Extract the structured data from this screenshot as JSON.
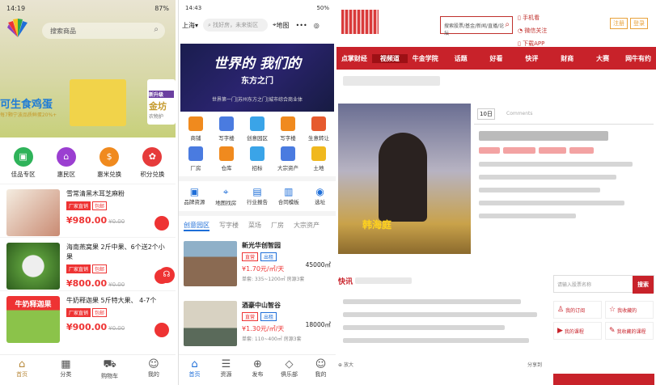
{
  "p1": {
    "status": {
      "time": "14:19",
      "battery": "87%"
    },
    "search_placeholder": "搜索商品",
    "banner": {
      "title": "可生食鸡蛋",
      "subtitle": "每7颗宁波品质鲜蛋20%+",
      "side_tag": "新升级",
      "side_title": "金坊",
      "side_sub": "农物护"
    },
    "categories": [
      {
        "label": "佳品专区"
      },
      {
        "label": "惠民区"
      },
      {
        "label": "惠米兑换"
      },
      {
        "label": "积分兑换"
      }
    ],
    "products": [
      {
        "name": "雪常清黑木耳芝麻粉",
        "tag1": "厂家直销",
        "tag2": "包邮",
        "price": "¥980.00",
        "old": "¥0.00"
      },
      {
        "name": "海南燕窝果 2斤中果、6个送2个小果",
        "tag1": "厂家直销",
        "tag2": "包邮",
        "price": "¥800.00",
        "old": "¥0.00"
      },
      {
        "name": "牛奶释迦果 5斤特大果、 4-7个",
        "tag1": "厂家直销",
        "tag2": "包邮",
        "price": "¥900.00",
        "old": "¥0.00",
        "img_text": "牛奶释迦果"
      }
    ],
    "nav": [
      {
        "label": "首页"
      },
      {
        "label": "分类"
      },
      {
        "label": "购物车"
      },
      {
        "label": "我的"
      }
    ]
  },
  "p2": {
    "status": {
      "time": "14:43",
      "battery": "50%"
    },
    "city": "上海",
    "search_placeholder": "找好房，未来街区",
    "map_label": "地图",
    "banner": {
      "line1": "世界的  我们的",
      "line2": "东方之门",
      "line3": "世界第一门|苏州东方之门|城市综合商业体"
    },
    "grid": [
      {
        "label": "商铺"
      },
      {
        "label": "写字楼"
      },
      {
        "label": "创意园区"
      },
      {
        "label": "写字楼"
      },
      {
        "label": "生意转让"
      },
      {
        "label": "厂房"
      },
      {
        "label": "仓库"
      },
      {
        "label": "招标"
      },
      {
        "label": "大宗资产"
      },
      {
        "label": "土地"
      }
    ],
    "services": [
      {
        "label": "品牌资源"
      },
      {
        "label": "地图找房"
      },
      {
        "label": "行业报告"
      },
      {
        "label": "合同模板"
      },
      {
        "label": "选址"
      }
    ],
    "tabs": [
      {
        "label": "创意园区"
      },
      {
        "label": "写字楼"
      },
      {
        "label": "菜场"
      },
      {
        "label": "厂房"
      },
      {
        "label": "大宗资产"
      }
    ],
    "listings": [
      {
        "name": "新光华创智园",
        "b1": "直营",
        "b2": "出租",
        "price": "¥1.70元/㎡/天",
        "area": "45000㎡",
        "sub": "单套: 335~1200㎡  房源3套"
      },
      {
        "name": "酒豪中山智谷",
        "b1": "直营",
        "b2": "出租",
        "price": "¥1.30元/㎡/天",
        "area": "18000㎡",
        "sub": "单套: 110~400㎡  房源3套"
      }
    ],
    "nav": [
      {
        "label": "首页"
      },
      {
        "label": "资源"
      },
      {
        "label": "发布"
      },
      {
        "label": "俱乐部"
      },
      {
        "label": "我的"
      }
    ]
  },
  "p3": {
    "search_placeholder": "搜索股票/基金/新闻/直播/论坛",
    "top_links": [
      "手机看",
      "微信关注",
      "下载APP"
    ],
    "login": [
      "注册",
      "登录"
    ],
    "nav": [
      "点掌财经",
      "视频道",
      "牛金学院",
      "话题",
      "好看",
      "快评",
      "财商",
      "大赛",
      "网牛有约"
    ],
    "video_caption": "韩海庭",
    "article_date": "10日",
    "article_comments": "Comments",
    "news_title": "快讯",
    "search2_placeholder": "请输入股票名称",
    "search2_btn": "搜索",
    "side_buttons": [
      "我的订阅",
      "我收藏的",
      "我的课程",
      "我收藏的课程"
    ],
    "footer_left": "放大",
    "footer_right": "分享到"
  }
}
